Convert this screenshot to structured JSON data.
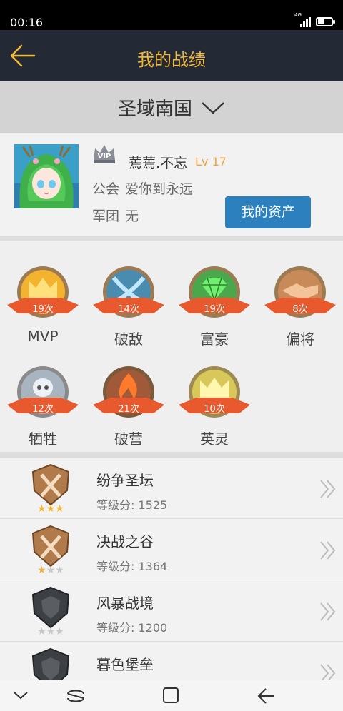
{
  "status": {
    "time": "00:16",
    "network": "4G"
  },
  "header": {
    "title": "我的战绩",
    "back_icon": "arrow-left-icon"
  },
  "server": {
    "name": "圣域南国",
    "dropdown_icon": "chevron-down-icon"
  },
  "profile": {
    "nickname": "蔫蔫.不忘",
    "level": "Lv 17",
    "guild_label": "公会",
    "guild_value": "爱你到永远",
    "legion_label": "军团",
    "legion_value": "无",
    "assets_button": "我的资产"
  },
  "badges": [
    {
      "name": "MVP",
      "count": "19次",
      "icon": "crown-icon"
    },
    {
      "name": "破敌",
      "count": "14次",
      "icon": "crossed-swords-icon"
    },
    {
      "name": "富豪",
      "count": "19次",
      "icon": "gem-icon"
    },
    {
      "name": "偏将",
      "count": "8次",
      "icon": "handshake-icon"
    },
    {
      "name": "牺牲",
      "count": "12次",
      "icon": "skull-icon"
    },
    {
      "name": "破营",
      "count": "21次",
      "icon": "flame-icon"
    },
    {
      "name": "英灵",
      "count": "10次",
      "icon": "crown-icon"
    }
  ],
  "ranks": [
    {
      "name": "纷争圣坛",
      "score": "等级分: 1525",
      "stars": 3,
      "tier": "bronze"
    },
    {
      "name": "决战之谷",
      "score": "等级分: 1364",
      "stars": 1,
      "tier": "bronze"
    },
    {
      "name": "风暴战境",
      "score": "等级分: 1200",
      "stars": 0,
      "tier": "iron"
    },
    {
      "name": "暮色堡垒",
      "score": "",
      "stars": 0,
      "tier": "iron"
    }
  ],
  "colors": {
    "header_bg": "#232a35",
    "accent": "#f0b73a",
    "button": "#2b80bd",
    "level": "#f0a23a",
    "ribbon": "#e85a2d"
  }
}
